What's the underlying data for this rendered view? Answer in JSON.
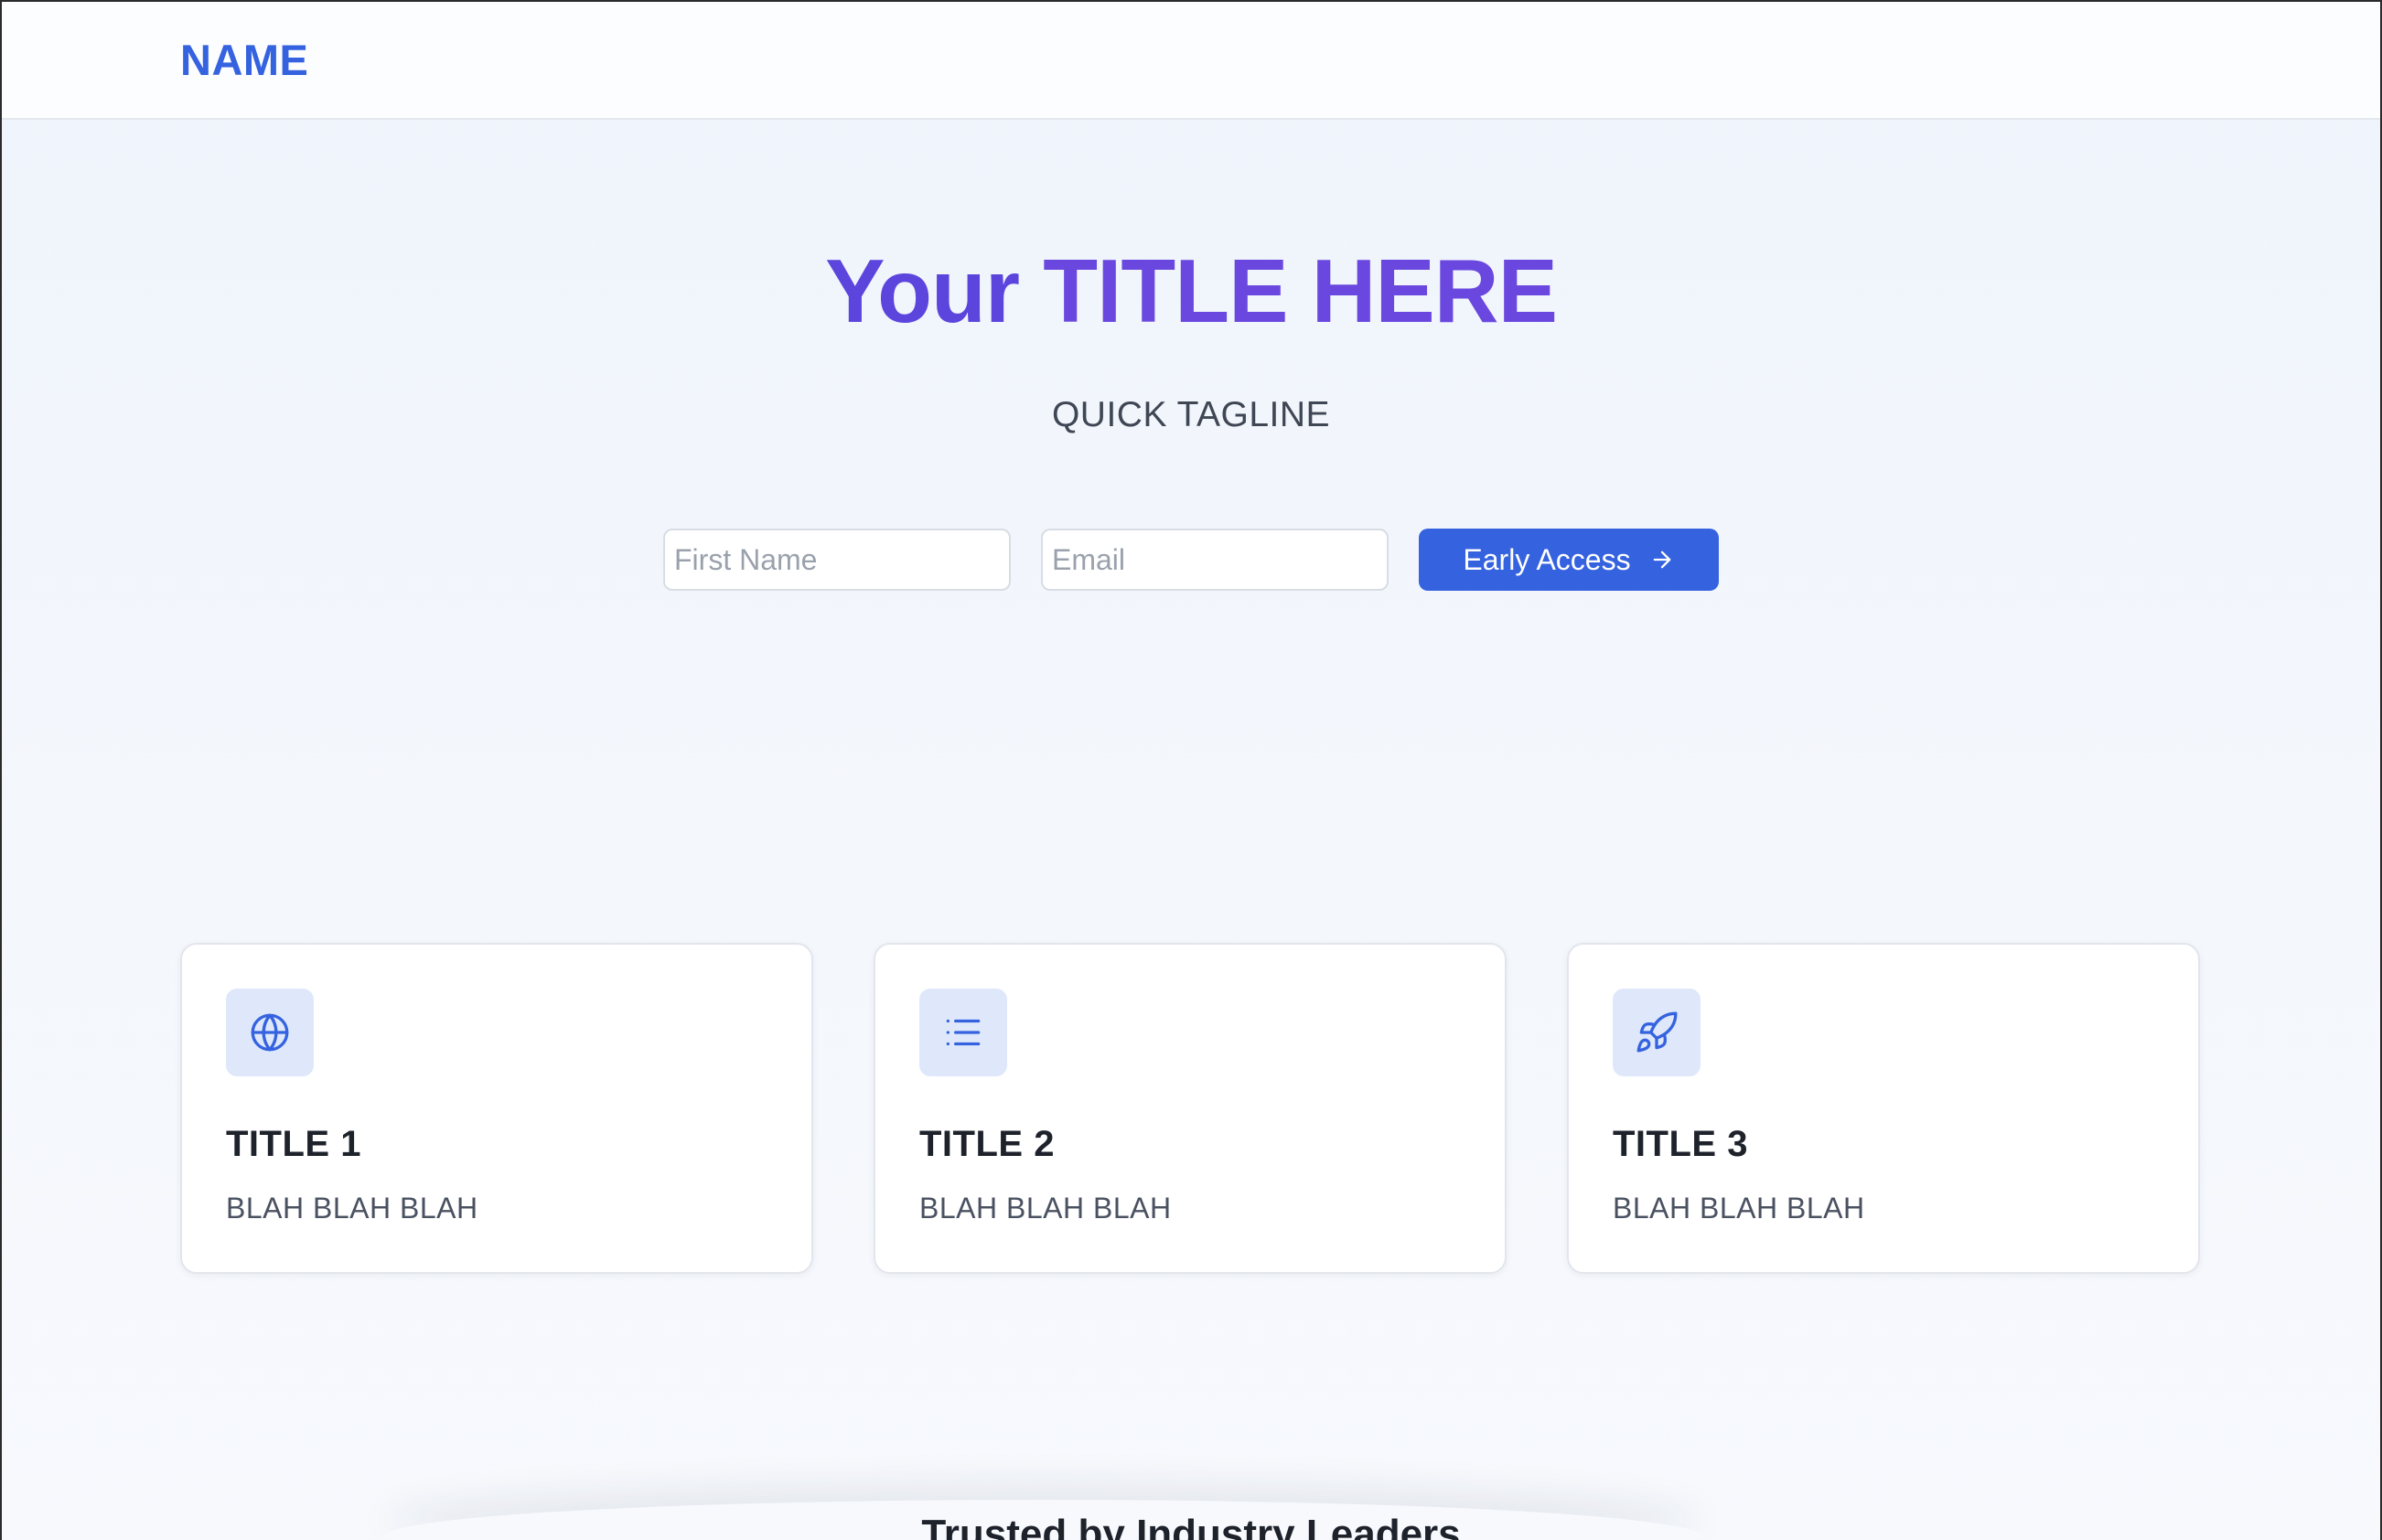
{
  "header": {
    "brand": "NAME"
  },
  "hero": {
    "title_part1": "Your ",
    "title_part2": "TITLE HERE",
    "tagline": "QUICK TAGLINE",
    "title_color": "#5b45dc"
  },
  "form": {
    "first_name_placeholder": "First Name",
    "first_name_value": "",
    "email_placeholder": "Email",
    "email_value": "",
    "cta_label": "Early Access",
    "cta_icon": "arrow-right-icon",
    "cta_color": "#3563e0"
  },
  "cards": [
    {
      "icon": "globe-icon",
      "title": "TITLE 1",
      "description": "BLAH BLAH BLAH"
    },
    {
      "icon": "list-icon",
      "title": "TITLE 2",
      "description": "BLAH BLAH BLAH"
    },
    {
      "icon": "rocket-icon",
      "title": "TITLE 3",
      "description": "BLAH BLAH BLAH"
    }
  ],
  "trusted": {
    "heading": "Trusted by Industry Leaders"
  },
  "colors": {
    "accent": "#3563e0",
    "icon_bg": "#dfe8fb",
    "page_bg": "#f1f5fc"
  }
}
